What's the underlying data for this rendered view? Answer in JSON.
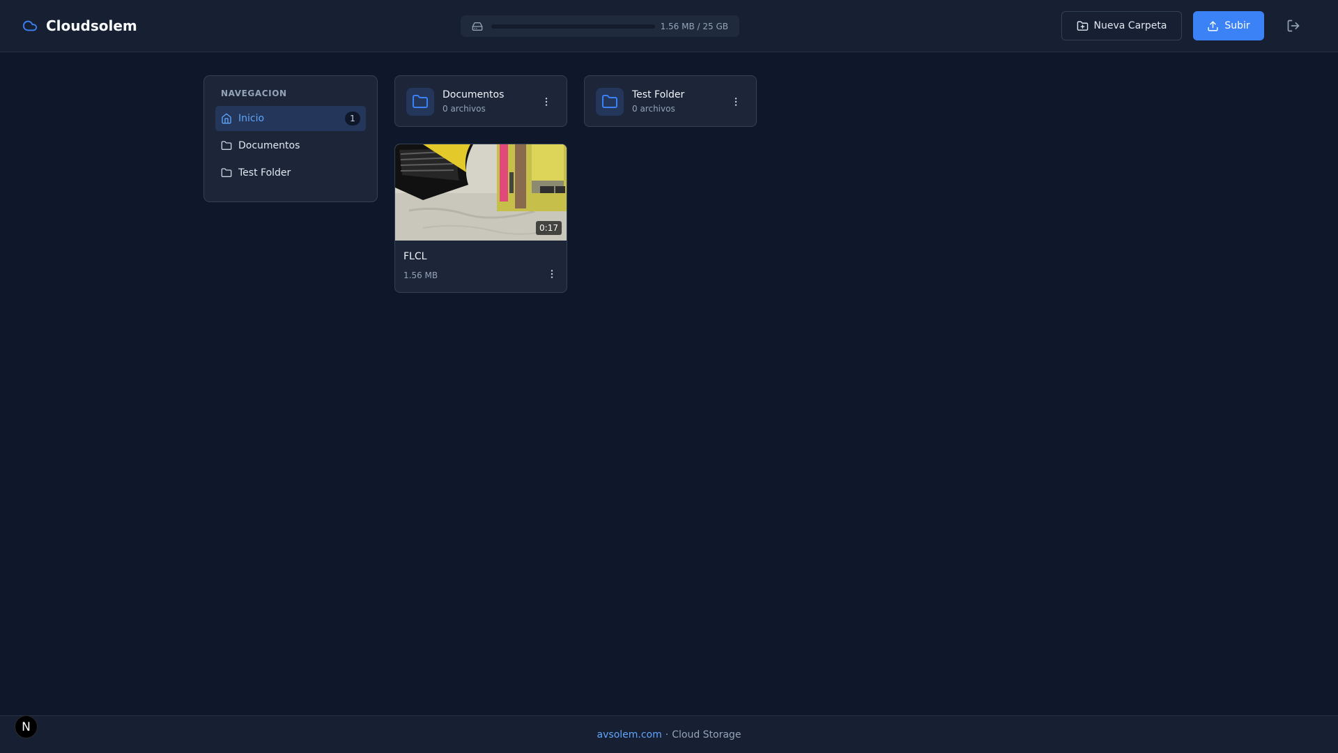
{
  "app": {
    "name": "Cloudsolem"
  },
  "storage": {
    "used_fraction": 0.0001,
    "text": "1.56 MB / 25 GB"
  },
  "toolbar": {
    "new_folder_label": "Nueva Carpeta",
    "upload_label": "Subir"
  },
  "sidebar": {
    "heading": "NAVEGACION",
    "items": [
      {
        "label": "Inicio",
        "badge": "1",
        "icon": "home-icon",
        "active": true
      },
      {
        "label": "Documentos",
        "icon": "folder-icon"
      },
      {
        "label": "Test Folder",
        "icon": "folder-icon"
      }
    ]
  },
  "folders": [
    {
      "name": "Documentos",
      "count": "0 archivos"
    },
    {
      "name": "Test Folder",
      "count": "0 archivos"
    }
  ],
  "files": [
    {
      "name": "FLCL",
      "size": "1.56 MB",
      "duration": "0:17",
      "type": "video"
    }
  ],
  "footer": {
    "link": "avsolem.com",
    "separator": "·",
    "text": "Cloud Storage"
  },
  "overlay": {
    "badge": "N"
  },
  "colors": {
    "accent": "#3b82f6",
    "background": "#0f172a",
    "surface": "#1c2638"
  }
}
